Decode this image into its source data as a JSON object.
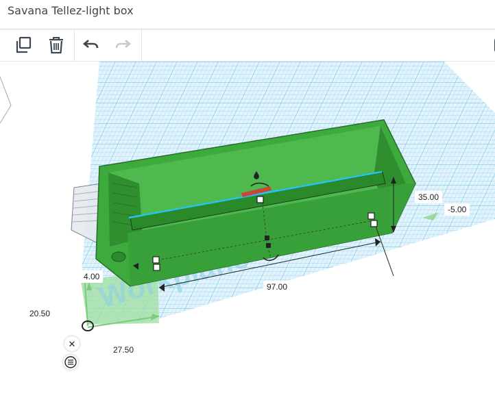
{
  "app": {
    "title": "Savana Tellez-light box"
  },
  "toolbar": {
    "buttons": [
      {
        "name": "copy",
        "icon": "copy-icon",
        "enabled": true
      },
      {
        "name": "delete",
        "icon": "trash-icon",
        "enabled": true
      },
      {
        "name": "undo",
        "icon": "undo-icon",
        "enabled": true
      },
      {
        "name": "redo",
        "icon": "redo-icon",
        "enabled": false
      }
    ]
  },
  "workplane": {
    "watermark": "Workplane"
  },
  "dimensions": {
    "height": "35.00",
    "elevation": "-5.00",
    "length": "97.00",
    "offset_small": "4.00",
    "pos_y": "20.50",
    "pos_x": "27.50"
  },
  "colors": {
    "shape": "#3daa3d",
    "grid": "#7fd0ee",
    "selection": "#25c5f0"
  }
}
